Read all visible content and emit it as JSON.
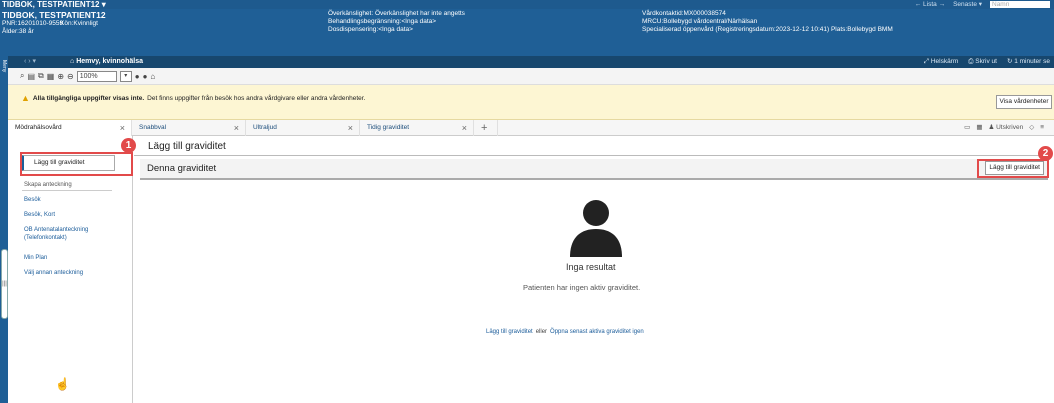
{
  "title_bar": {
    "title": "TIDBOK, TESTPATIENT12",
    "list": "← Lista →",
    "latest": "Senaste ▾",
    "search_placeholder": "Namn"
  },
  "patient": {
    "name": "TIDBOK, TESTPATIENT12",
    "pnr": "PNR:16201010-9559",
    "gender": "Kön:Kvinnligt",
    "age": "Ålder:38 år"
  },
  "overview": {
    "line1": "Överkänslighet: Överkänslighet har inte angetts",
    "line2": "Behandlingsbegränsning:<Inga data>",
    "line3": "Dosdispensering:<Inga data>"
  },
  "contact": {
    "line1": "Vårdkontaktid:MX000038574",
    "line2": "MRCU:Bollebygd vårdcentral/Närhälsan",
    "line3": "Specialiserad öppenvård (Registreringsdatum:2023-12-12 10:41) Plats:Bollebygd BMM"
  },
  "nav": {
    "home": "Hemvy, kvinnohälsa",
    "fullscreen": "Helskärm",
    "print": "Skriv ut",
    "refresh": "1 minuter se"
  },
  "sidemenu_label": "Meny",
  "toolbar": {
    "zoom": "100%"
  },
  "warning": {
    "bold": "Alla tillgängliga uppgifter visas inte.",
    "text": "Det finns uppgifter från besök hos andra vårdgivare eller andra vårdenheter.",
    "button": "Visa vårdenheter"
  },
  "tabs": [
    {
      "label": "Mödrahälsovård"
    },
    {
      "label": "Snabbval"
    },
    {
      "label": "Ultraljud"
    },
    {
      "label": "Tidig graviditet"
    }
  ],
  "tabs_right": {
    "printed": "Utskriven"
  },
  "sidebar": {
    "add_button": "Lägg till graviditet",
    "section": "Skapa anteckning",
    "links": [
      "Besök",
      "Besök, Kort",
      "OB Antenatalanteckning (Telefonkontakt)",
      "Min Plan",
      "Välj annan anteckning"
    ]
  },
  "main": {
    "title": "Lägg till graviditet",
    "section_title": "Denna graviditet",
    "add_button": "Lägg till graviditet",
    "empty_title": "Inga resultat",
    "empty_text": "Patienten har ingen aktiv graviditet.",
    "link_add": "Lägg till graviditet",
    "link_or": "eller",
    "link_open": "Öppna senast aktiva graviditet igen"
  },
  "annotations": {
    "badge1": "1",
    "badge2": "2"
  },
  "colors": {
    "header": "#1f5f96",
    "highlight": "#e24a4a",
    "warning_bg": "#fdf6d3",
    "link": "#1b5c9a"
  }
}
